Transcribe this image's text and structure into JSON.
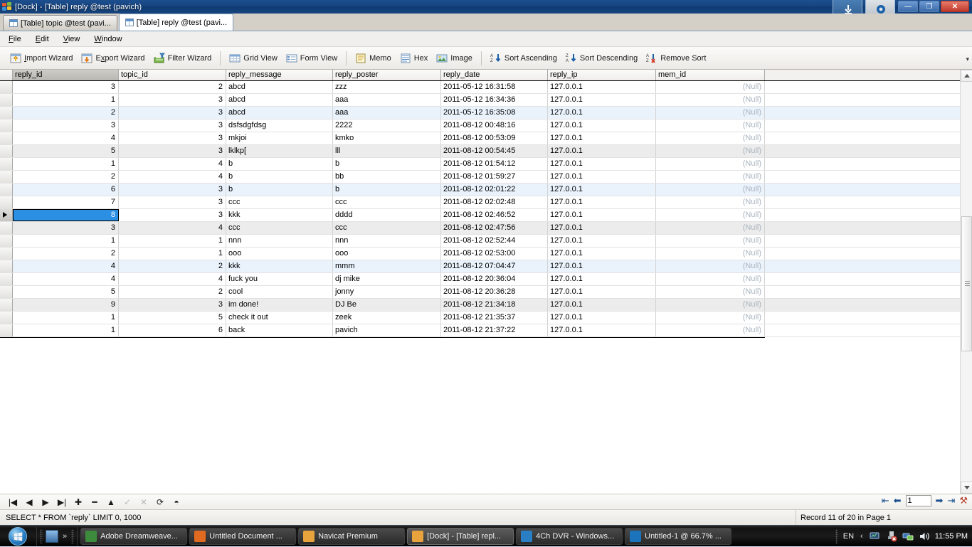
{
  "window": {
    "title": "[Dock] - [Table] reply @test (pavich)",
    "icon": "navicat-icon",
    "controls": {
      "minimize": "—",
      "restore": "❐",
      "close": "✕"
    }
  },
  "tabs": [
    {
      "label": "[Table] topic @test (pavi...",
      "icon": "table-icon",
      "active": false
    },
    {
      "label": "[Table] reply @test (pavi...",
      "icon": "table-icon",
      "active": true
    }
  ],
  "menubar": [
    {
      "label": "File",
      "accel": "F"
    },
    {
      "label": "Edit",
      "accel": "E"
    },
    {
      "label": "View",
      "accel": "V"
    },
    {
      "label": "Window",
      "accel": "W"
    }
  ],
  "toolbar": {
    "groups": [
      [
        {
          "label": "Import Wizard",
          "icon": "import-wizard-icon"
        },
        {
          "label": "Export Wizard",
          "icon": "export-wizard-icon"
        },
        {
          "label": "Filter Wizard",
          "icon": "filter-wizard-icon"
        }
      ],
      [
        {
          "label": "Grid View",
          "icon": "grid-view-icon"
        },
        {
          "label": "Form View",
          "icon": "form-view-icon"
        }
      ],
      [
        {
          "label": "Memo",
          "icon": "memo-icon"
        },
        {
          "label": "Hex",
          "icon": "hex-icon"
        },
        {
          "label": "Image",
          "icon": "image-icon"
        }
      ],
      [
        {
          "label": "Sort Ascending",
          "icon": "sort-ascending-icon"
        },
        {
          "label": "Sort Descending",
          "icon": "sort-descending-icon"
        },
        {
          "label": "Remove Sort",
          "icon": "remove-sort-icon"
        }
      ]
    ],
    "overflow": "▾"
  },
  "grid": {
    "columns": [
      {
        "key": "reply_id",
        "label": "reply_id",
        "width": 149,
        "align": "right",
        "sorted": true
      },
      {
        "key": "topic_id",
        "label": "topic_id",
        "width": 151,
        "align": "right",
        "sorted": false
      },
      {
        "key": "reply_message",
        "label": "reply_message",
        "width": 150,
        "align": "left",
        "sorted": false
      },
      {
        "key": "reply_poster",
        "label": "reply_poster",
        "width": 152,
        "align": "left",
        "sorted": false
      },
      {
        "key": "reply_date",
        "label": "reply_date",
        "width": 150,
        "align": "left",
        "sorted": false
      },
      {
        "key": "reply_ip",
        "label": "reply_ip",
        "width": 152,
        "align": "left",
        "sorted": false
      },
      {
        "key": "mem_id",
        "label": "mem_id",
        "width": 153,
        "align": "right",
        "sorted": false
      }
    ],
    "null_text": "(Null)",
    "selected_row_index": 10,
    "selected_column": "reply_id",
    "rows": [
      {
        "shade": "white",
        "reply_id": "3",
        "topic_id": "2",
        "reply_message": "abcd",
        "reply_poster": "zzz",
        "reply_date": "2011-05-12 16:31:58",
        "reply_ip": "127.0.0.1",
        "mem_id": "(Null)"
      },
      {
        "shade": "white",
        "reply_id": "1",
        "topic_id": "3",
        "reply_message": "abcd",
        "reply_poster": "aaa",
        "reply_date": "2011-05-12 16:34:36",
        "reply_ip": "127.0.0.1",
        "mem_id": "(Null)"
      },
      {
        "shade": "blue",
        "reply_id": "2",
        "topic_id": "3",
        "reply_message": "abcd",
        "reply_poster": "aaa",
        "reply_date": "2011-05-12 16:35:08",
        "reply_ip": "127.0.0.1",
        "mem_id": "(Null)"
      },
      {
        "shade": "white",
        "reply_id": "3",
        "topic_id": "3",
        "reply_message": "dsfsdgfdsg",
        "reply_poster": "2222",
        "reply_date": "2011-08-12 00:48:16",
        "reply_ip": "127.0.0.1",
        "mem_id": "(Null)"
      },
      {
        "shade": "white",
        "reply_id": "4",
        "topic_id": "3",
        "reply_message": "mkjoi",
        "reply_poster": "kmko",
        "reply_date": "2011-08-12 00:53:09",
        "reply_ip": "127.0.0.1",
        "mem_id": "(Null)"
      },
      {
        "shade": "gray",
        "reply_id": "5",
        "topic_id": "3",
        "reply_message": "lklkp[",
        "reply_poster": "lll",
        "reply_date": "2011-08-12 00:54:45",
        "reply_ip": "127.0.0.1",
        "mem_id": "(Null)"
      },
      {
        "shade": "white",
        "reply_id": "1",
        "topic_id": "4",
        "reply_message": "b",
        "reply_poster": "b",
        "reply_date": "2011-08-12 01:54:12",
        "reply_ip": "127.0.0.1",
        "mem_id": "(Null)"
      },
      {
        "shade": "white",
        "reply_id": "2",
        "topic_id": "4",
        "reply_message": "b",
        "reply_poster": "bb",
        "reply_date": "2011-08-12 01:59:27",
        "reply_ip": "127.0.0.1",
        "mem_id": "(Null)"
      },
      {
        "shade": "blue",
        "reply_id": "6",
        "topic_id": "3",
        "reply_message": "b",
        "reply_poster": "b",
        "reply_date": "2011-08-12 02:01:22",
        "reply_ip": "127.0.0.1",
        "mem_id": "(Null)"
      },
      {
        "shade": "white",
        "reply_id": "7",
        "topic_id": "3",
        "reply_message": "ccc",
        "reply_poster": "ccc",
        "reply_date": "2011-08-12 02:02:48",
        "reply_ip": "127.0.0.1",
        "mem_id": "(Null)"
      },
      {
        "shade": "white",
        "reply_id": "8",
        "topic_id": "3",
        "reply_message": "kkk",
        "reply_poster": "dddd",
        "reply_date": "2011-08-12 02:46:52",
        "reply_ip": "127.0.0.1",
        "mem_id": "(Null)"
      },
      {
        "shade": "gray",
        "reply_id": "3",
        "topic_id": "4",
        "reply_message": "ccc",
        "reply_poster": "ccc",
        "reply_date": "2011-08-12 02:47:56",
        "reply_ip": "127.0.0.1",
        "mem_id": "(Null)"
      },
      {
        "shade": "white",
        "reply_id": "1",
        "topic_id": "1",
        "reply_message": "nnn",
        "reply_poster": "nnn",
        "reply_date": "2011-08-12 02:52:44",
        "reply_ip": "127.0.0.1",
        "mem_id": "(Null)"
      },
      {
        "shade": "white",
        "reply_id": "2",
        "topic_id": "1",
        "reply_message": "ooo",
        "reply_poster": "ooo",
        "reply_date": "2011-08-12 02:53:00",
        "reply_ip": "127.0.0.1",
        "mem_id": "(Null)"
      },
      {
        "shade": "blue",
        "reply_id": "4",
        "topic_id": "2",
        "reply_message": "kkk",
        "reply_poster": "mmm",
        "reply_date": "2011-08-12 07:04:47",
        "reply_ip": "127.0.0.1",
        "mem_id": "(Null)"
      },
      {
        "shade": "white",
        "reply_id": "4",
        "topic_id": "4",
        "reply_message": "fuck you",
        "reply_poster": "dj mike",
        "reply_date": "2011-08-12 20:36:04",
        "reply_ip": "127.0.0.1",
        "mem_id": "(Null)"
      },
      {
        "shade": "white",
        "reply_id": "5",
        "topic_id": "2",
        "reply_message": "cool",
        "reply_poster": "jonny",
        "reply_date": "2011-08-12 20:36:28",
        "reply_ip": "127.0.0.1",
        "mem_id": "(Null)"
      },
      {
        "shade": "gray",
        "reply_id": "9",
        "topic_id": "3",
        "reply_message": "im done!",
        "reply_poster": "DJ Be",
        "reply_date": "2011-08-12 21:34:18",
        "reply_ip": "127.0.0.1",
        "mem_id": "(Null)"
      },
      {
        "shade": "white",
        "reply_id": "1",
        "topic_id": "5",
        "reply_message": "check it out",
        "reply_poster": "zeek",
        "reply_date": "2011-08-12 21:35:37",
        "reply_ip": "127.0.0.1",
        "mem_id": "(Null)"
      },
      {
        "shade": "white",
        "reply_id": "1",
        "topic_id": "6",
        "reply_message": "back",
        "reply_poster": "pavich",
        "reply_date": "2011-08-12 21:37:22",
        "reply_ip": "127.0.0.1",
        "mem_id": "(Null)"
      }
    ]
  },
  "navbar": {
    "buttons": [
      {
        "name": "first-record",
        "glyph": "|◀"
      },
      {
        "name": "previous-record",
        "glyph": "◀"
      },
      {
        "name": "next-record",
        "glyph": "▶"
      },
      {
        "name": "last-record",
        "glyph": "▶|"
      },
      {
        "name": "add-record",
        "glyph": "✚"
      },
      {
        "name": "delete-record",
        "glyph": "━"
      },
      {
        "name": "apply-change",
        "glyph": "▲"
      },
      {
        "name": "confirm-edit",
        "glyph": "✓"
      },
      {
        "name": "cancel-edit",
        "glyph": "✕"
      },
      {
        "name": "refresh",
        "glyph": "⟳"
      },
      {
        "name": "stop",
        "glyph": "◓"
      }
    ],
    "page_value": "1",
    "page_buttons": [
      {
        "name": "first-page",
        "glyph": "⇤"
      },
      {
        "name": "previous-page",
        "glyph": "⬅"
      },
      {
        "name": "next-page",
        "glyph": "➡"
      },
      {
        "name": "last-page",
        "glyph": "⇥"
      },
      {
        "name": "page-settings",
        "glyph": "⚒"
      }
    ]
  },
  "statusbar": {
    "sql": "SELECT * FROM `reply` LIMIT 0, 1000",
    "record_info": "Record 11 of 20 in Page 1"
  },
  "taskbar": {
    "start": "start-orb",
    "quicklaunch": {
      "show_desktop": "show-desktop-icon",
      "chevron": "»"
    },
    "tasks": [
      {
        "label": "Adobe Dreamweave...",
        "icon": "dreamweaver-icon",
        "active": false
      },
      {
        "label": "Untitled Document ...",
        "icon": "firefox-icon",
        "active": false
      },
      {
        "label": "Navicat Premium",
        "icon": "navicat-icon",
        "active": false
      },
      {
        "label": "[Dock] - [Table] repl...",
        "icon": "navicat-icon",
        "active": true
      },
      {
        "label": "4Ch DVR - Windows...",
        "icon": "ie-icon",
        "active": false
      },
      {
        "label": "Untitled-1 @ 66.7% ...",
        "icon": "photoshop-icon",
        "active": false
      }
    ],
    "tray": {
      "language": "EN",
      "chevron": "‹",
      "icons": [
        "network-monitor-icon",
        "safely-remove-icon",
        "network-icon",
        "volume-icon"
      ],
      "clock": "11:55 PM"
    }
  },
  "colors": {
    "selection": "#2b8fe3",
    "row_blue": "#eaf3fc",
    "row_gray": "#ececec",
    "titlebar": "#17457f",
    "null_text": "#a9b4bf"
  }
}
